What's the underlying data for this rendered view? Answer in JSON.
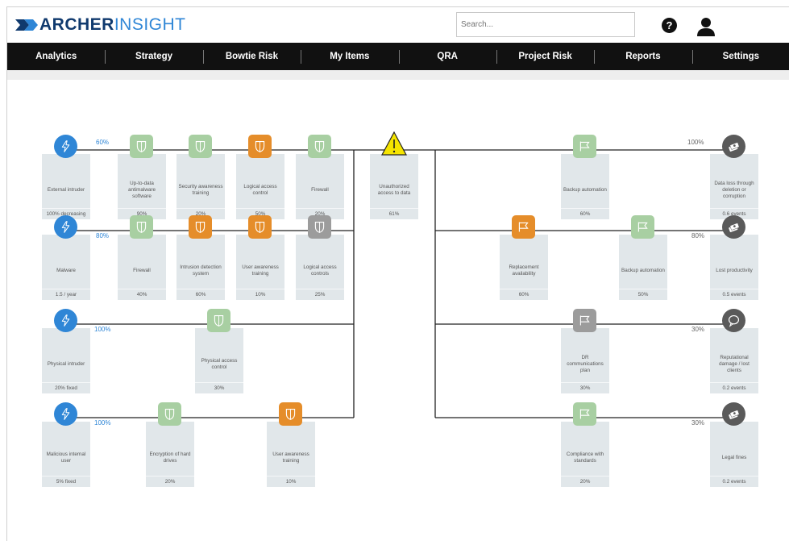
{
  "header": {
    "logo_primary": "ARCHER",
    "logo_secondary": "INSIGHT",
    "search_placeholder": "Search...",
    "help_symbol": "?"
  },
  "nav": [
    "Analytics",
    "Strategy",
    "Bowtie Risk",
    "My Items",
    "QRA",
    "Project Risk",
    "Reports",
    "Settings"
  ],
  "colors": {
    "threat": "#2f86d6",
    "control_effective": "#a8cfa2",
    "control_weak": "#e58d2a",
    "control_unknown": "#9c9c9c",
    "consequence": "#5a5a5a",
    "event": "#f5e400"
  },
  "bowtie": {
    "top_event": {
      "label": "Unauthorized access to data",
      "value": "61%",
      "icon": "warning-icon"
    },
    "threats": [
      {
        "label": "External intruder",
        "value": "100% decreasing",
        "percent": "60%",
        "icon": "lightning-icon",
        "controls": [
          {
            "label": "Up-to-data antimalware software",
            "value": "90%",
            "status": "green",
            "icon": "shield-icon"
          },
          {
            "label": "Security awareness training",
            "value": "20%",
            "status": "green",
            "icon": "shield-icon"
          },
          {
            "label": "Logical access control",
            "value": "50%",
            "status": "orange",
            "icon": "shield-icon"
          },
          {
            "label": "Firewall",
            "value": "20%",
            "status": "green",
            "icon": "shield-icon"
          }
        ]
      },
      {
        "label": "Malware",
        "value": "1.5 / year",
        "percent": "80%",
        "icon": "lightning-icon",
        "controls": [
          {
            "label": "Firewall",
            "value": "40%",
            "status": "green",
            "icon": "shield-icon"
          },
          {
            "label": "Intrusion detection system",
            "value": "60%",
            "status": "orange",
            "icon": "shield-icon"
          },
          {
            "label": "User awareness training",
            "value": "10%",
            "status": "orange",
            "icon": "shield-icon"
          },
          {
            "label": "Logical access controls",
            "value": "25%",
            "status": "gray",
            "icon": "shield-icon"
          }
        ]
      },
      {
        "label": "Physical intruder",
        "value": "20% fixed",
        "percent": "100%",
        "icon": "lightning-icon",
        "controls": [
          {
            "label": "Physical access control",
            "value": "30%",
            "status": "green",
            "icon": "shield-icon"
          }
        ]
      },
      {
        "label": "Malicious internal user",
        "value": "5% fixed",
        "percent": "100%",
        "icon": "lightning-icon",
        "controls": [
          {
            "label": "Encryption of hard drives",
            "value": "20%",
            "status": "green",
            "icon": "shield-icon"
          },
          {
            "label": "User awareness training",
            "value": "10%",
            "status": "orange",
            "icon": "shield-icon"
          }
        ]
      }
    ],
    "consequences": [
      {
        "label": "Data loss through deletion or corruption",
        "value": "0.6 events",
        "percent": "100%",
        "icon": "money-stack-icon",
        "controls": [
          {
            "label": "Backup automation",
            "value": "60%",
            "status": "green",
            "icon": "flag-icon"
          }
        ]
      },
      {
        "label": "Lost productivity",
        "value": "0.5 events",
        "percent": "80%",
        "icon": "money-stack-icon",
        "controls": [
          {
            "label": "Replacement availability",
            "value": "60%",
            "status": "orange",
            "icon": "flag-icon"
          },
          {
            "label": "Backup automation",
            "value": "50%",
            "status": "green",
            "icon": "flag-icon"
          }
        ]
      },
      {
        "label": "Reputational damage / lost clients",
        "value": "0.2 events",
        "percent": "30%",
        "icon": "speech-bubble-icon",
        "controls": [
          {
            "label": "DR communications plan",
            "value": "30%",
            "status": "gray",
            "icon": "flag-icon"
          }
        ]
      },
      {
        "label": "Legal fines",
        "value": "0.2 events",
        "percent": "30%",
        "icon": "money-stack-icon",
        "controls": [
          {
            "label": "Compliance with standards",
            "value": "20%",
            "status": "green",
            "icon": "flag-icon"
          }
        ]
      }
    ]
  }
}
